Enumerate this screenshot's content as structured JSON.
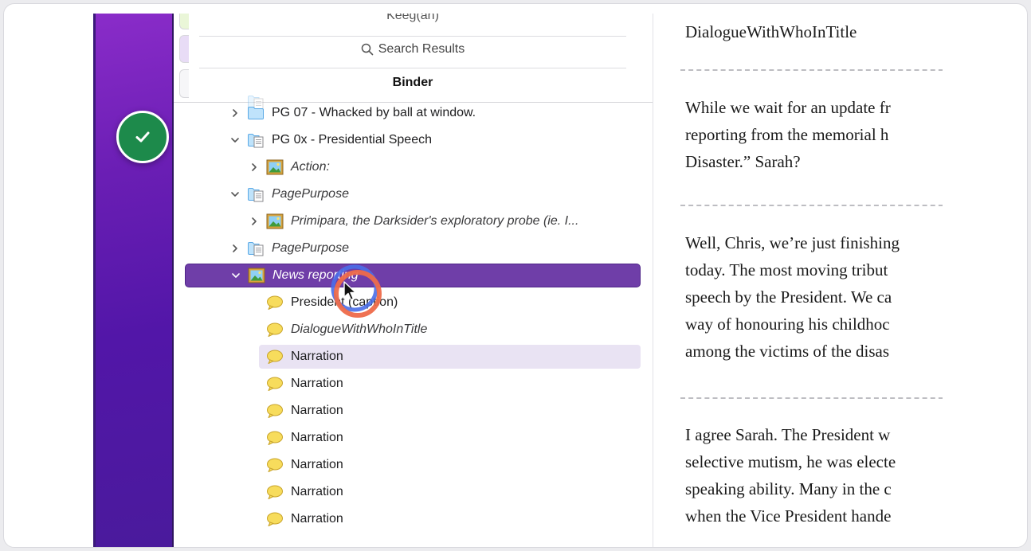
{
  "binder": {
    "tabs": {
      "top_partial": "Keeg(an)",
      "search_results": "Search Results",
      "binder": "Binder"
    },
    "items": [
      {
        "label": "PG 07 - Whacked by ball at window.",
        "icon": "folder-icon",
        "chevron": "right",
        "italic": false
      },
      {
        "label": "PG 0x - Presidential Speech",
        "icon": "folder-doc-icon",
        "chevron": "down",
        "italic": false
      },
      {
        "label": "Action:",
        "icon": "image-icon",
        "chevron": "right",
        "italic": true
      },
      {
        "label": "PagePurpose",
        "icon": "folder-doc-icon",
        "chevron": "down",
        "italic": true
      },
      {
        "label": "Primipara, the Darksider's exploratory probe (ie. I...",
        "icon": "image-icon",
        "chevron": "right",
        "italic": true
      },
      {
        "label": "PagePurpose",
        "icon": "folder-doc-icon",
        "chevron": "right",
        "italic": true
      },
      {
        "label": "News reporting",
        "icon": "image-icon",
        "chevron": "down",
        "italic": true,
        "selected": true
      },
      {
        "label": "President (caption)",
        "icon": "speech-bubble-icon",
        "italic": false
      },
      {
        "label": "DialogueWithWhoInTitle",
        "icon": "speech-bubble-icon",
        "italic": true
      },
      {
        "label": "Narration",
        "icon": "speech-bubble-icon",
        "italic": false,
        "highlighted": true
      },
      {
        "label": "Narration",
        "icon": "speech-bubble-icon",
        "italic": false
      },
      {
        "label": "Narration",
        "icon": "speech-bubble-icon",
        "italic": false
      },
      {
        "label": "Narration",
        "icon": "speech-bubble-icon",
        "italic": false
      },
      {
        "label": "Narration",
        "icon": "speech-bubble-icon",
        "italic": false
      },
      {
        "label": "Narration",
        "icon": "speech-bubble-icon",
        "italic": false
      },
      {
        "label": "Narration",
        "icon": "speech-bubble-icon",
        "italic": false
      }
    ]
  },
  "editor": {
    "heading": "DialogueWithWhoInTitle",
    "para1": [
      "While we wait for an update fr",
      "reporting from the memorial h",
      "Disaster.” Sarah?"
    ],
    "para2": [
      "Well, Chris, we’re just finishing",
      "today. The most moving tribut",
      "speech by the President. We ca",
      "way of honouring his childhoc",
      "among the victims of the disas"
    ],
    "para3": [
      "I agree Sarah. The President w",
      "selective mutism, he was electe",
      "speaking ability. Many in the c",
      "when the Vice President hande"
    ]
  },
  "colors": {
    "selection": "#6f3ea8",
    "highlight_row": "#e9e3f3",
    "desktop_purple": "#5216a8",
    "check_green": "#1d8a4b",
    "bubble_yellow": "#f7dc5c"
  }
}
